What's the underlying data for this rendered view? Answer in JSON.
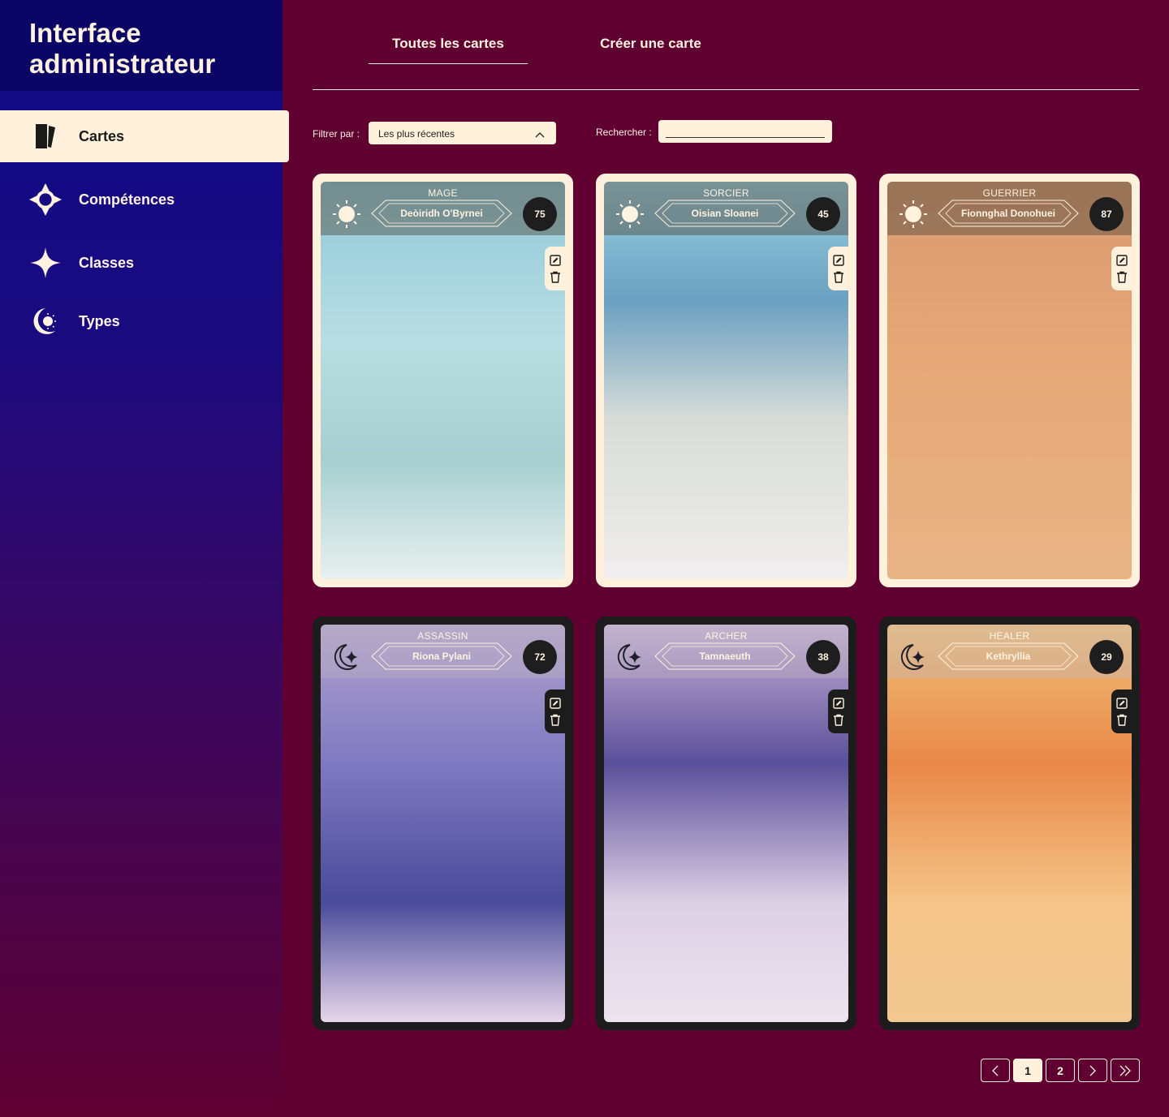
{
  "sidebar": {
    "title": "Interface administrateur",
    "items": [
      {
        "label": "Cartes",
        "icon": "cards-icon",
        "active": true
      },
      {
        "label": "Compétences",
        "icon": "compass-icon",
        "active": false
      },
      {
        "label": "Classes",
        "icon": "star-icon",
        "active": false
      },
      {
        "label": "Types",
        "icon": "eclipse-icon",
        "active": false
      }
    ]
  },
  "tabs": {
    "all": "Toutes les cartes",
    "create": "Créer une carte"
  },
  "filters": {
    "filter_label": "Filtrer par :",
    "filter_value": "Les plus récentes",
    "search_label": "Rechercher :",
    "search_value": ""
  },
  "cards": [
    {
      "class": "MAGE",
      "name": "Deòiridh O'Byrnei",
      "value": "75",
      "type_icon": "sun-icon",
      "theme": "light"
    },
    {
      "class": "SORCIER",
      "name": "Oisian Sloanei",
      "value": "45",
      "type_icon": "sun-icon",
      "theme": "light"
    },
    {
      "class": "GUERRIER",
      "name": "Fionnghal Donohuei",
      "value": "87",
      "type_icon": "sun-icon",
      "theme": "light"
    },
    {
      "class": "ASSASSIN",
      "name": "Riona Pylani",
      "value": "72",
      "type_icon": "moon-star-icon",
      "theme": "dark"
    },
    {
      "class": "ARCHER",
      "name": "Tamnaeuth",
      "value": "38",
      "type_icon": "moon-star-icon",
      "theme": "dark"
    },
    {
      "class": "HEALER",
      "name": "Kethryllia",
      "value": "29",
      "type_icon": "moon-star-icon",
      "theme": "dark"
    }
  ],
  "pagination": {
    "pages": [
      "1",
      "2"
    ],
    "current": "1"
  },
  "colors": {
    "background": "#5f0030",
    "cream": "#fff1dc",
    "sidebar_top": "#0e0a86",
    "card_dark": "#1c1c1c"
  }
}
